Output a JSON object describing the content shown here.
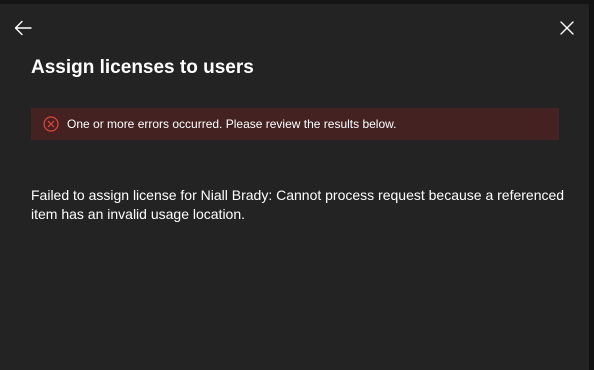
{
  "panel": {
    "title": "Assign licenses to users",
    "back_icon": "arrow-left-icon",
    "close_icon": "close-icon"
  },
  "error_banner": {
    "icon": "error-circle-icon",
    "message": "One or more errors occurred. Please review the results below.",
    "background_color": "#442222",
    "icon_color": "#e0433c"
  },
  "result": {
    "message": "Failed to assign license for Niall Brady: Cannot process request because a referenced item has an invalid usage location."
  }
}
